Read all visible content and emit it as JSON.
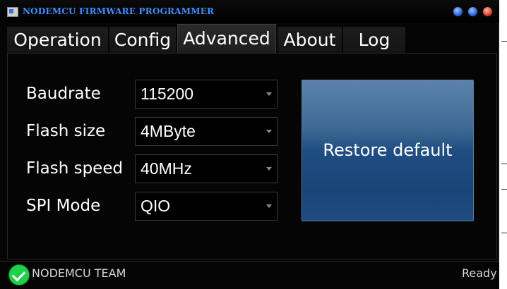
{
  "window": {
    "title": "NODEMCU FIRMWARE PROGRAMMER"
  },
  "tabs": [
    {
      "label": "Operation",
      "active": false
    },
    {
      "label": "Config",
      "active": false
    },
    {
      "label": "Advanced",
      "active": true
    },
    {
      "label": "About",
      "active": false
    },
    {
      "label": "Log",
      "active": false
    }
  ],
  "advanced": {
    "fields": [
      {
        "label": "Baudrate",
        "value": "115200"
      },
      {
        "label": "Flash size",
        "value": "4MByte"
      },
      {
        "label": "Flash speed",
        "value": "40MHz"
      },
      {
        "label": "SPI Mode",
        "value": "QIO"
      }
    ],
    "restore_label": "Restore default"
  },
  "status": {
    "team": "NODEMCU TEAM",
    "state": "Ready"
  },
  "colors": {
    "title_text": "#3f8cff",
    "button_blue": "#204e82",
    "ok_green": "#21d04a",
    "close_red": "#e2402f"
  },
  "icons": {
    "app": "app-icon",
    "minimize": "minimize-icon",
    "maximize": "maximize-icon",
    "close": "close-icon",
    "status_ok": "checkmark-icon",
    "dropdown": "chevron-down-icon"
  }
}
